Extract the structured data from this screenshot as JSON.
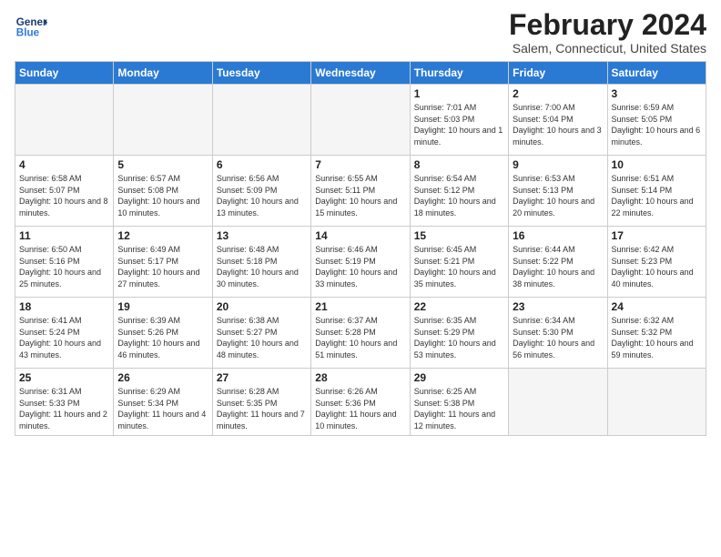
{
  "header": {
    "logo_line1": "General",
    "logo_line2": "Blue",
    "month_title": "February 2024",
    "location": "Salem, Connecticut, United States"
  },
  "weekdays": [
    "Sunday",
    "Monday",
    "Tuesday",
    "Wednesday",
    "Thursday",
    "Friday",
    "Saturday"
  ],
  "weeks": [
    [
      {
        "day": "",
        "info": ""
      },
      {
        "day": "",
        "info": ""
      },
      {
        "day": "",
        "info": ""
      },
      {
        "day": "",
        "info": ""
      },
      {
        "day": "1",
        "info": "Sunrise: 7:01 AM\nSunset: 5:03 PM\nDaylight: 10 hours and 1 minute."
      },
      {
        "day": "2",
        "info": "Sunrise: 7:00 AM\nSunset: 5:04 PM\nDaylight: 10 hours and 3 minutes."
      },
      {
        "day": "3",
        "info": "Sunrise: 6:59 AM\nSunset: 5:05 PM\nDaylight: 10 hours and 6 minutes."
      }
    ],
    [
      {
        "day": "4",
        "info": "Sunrise: 6:58 AM\nSunset: 5:07 PM\nDaylight: 10 hours and 8 minutes."
      },
      {
        "day": "5",
        "info": "Sunrise: 6:57 AM\nSunset: 5:08 PM\nDaylight: 10 hours and 10 minutes."
      },
      {
        "day": "6",
        "info": "Sunrise: 6:56 AM\nSunset: 5:09 PM\nDaylight: 10 hours and 13 minutes."
      },
      {
        "day": "7",
        "info": "Sunrise: 6:55 AM\nSunset: 5:11 PM\nDaylight: 10 hours and 15 minutes."
      },
      {
        "day": "8",
        "info": "Sunrise: 6:54 AM\nSunset: 5:12 PM\nDaylight: 10 hours and 18 minutes."
      },
      {
        "day": "9",
        "info": "Sunrise: 6:53 AM\nSunset: 5:13 PM\nDaylight: 10 hours and 20 minutes."
      },
      {
        "day": "10",
        "info": "Sunrise: 6:51 AM\nSunset: 5:14 PM\nDaylight: 10 hours and 22 minutes."
      }
    ],
    [
      {
        "day": "11",
        "info": "Sunrise: 6:50 AM\nSunset: 5:16 PM\nDaylight: 10 hours and 25 minutes."
      },
      {
        "day": "12",
        "info": "Sunrise: 6:49 AM\nSunset: 5:17 PM\nDaylight: 10 hours and 27 minutes."
      },
      {
        "day": "13",
        "info": "Sunrise: 6:48 AM\nSunset: 5:18 PM\nDaylight: 10 hours and 30 minutes."
      },
      {
        "day": "14",
        "info": "Sunrise: 6:46 AM\nSunset: 5:19 PM\nDaylight: 10 hours and 33 minutes."
      },
      {
        "day": "15",
        "info": "Sunrise: 6:45 AM\nSunset: 5:21 PM\nDaylight: 10 hours and 35 minutes."
      },
      {
        "day": "16",
        "info": "Sunrise: 6:44 AM\nSunset: 5:22 PM\nDaylight: 10 hours and 38 minutes."
      },
      {
        "day": "17",
        "info": "Sunrise: 6:42 AM\nSunset: 5:23 PM\nDaylight: 10 hours and 40 minutes."
      }
    ],
    [
      {
        "day": "18",
        "info": "Sunrise: 6:41 AM\nSunset: 5:24 PM\nDaylight: 10 hours and 43 minutes."
      },
      {
        "day": "19",
        "info": "Sunrise: 6:39 AM\nSunset: 5:26 PM\nDaylight: 10 hours and 46 minutes."
      },
      {
        "day": "20",
        "info": "Sunrise: 6:38 AM\nSunset: 5:27 PM\nDaylight: 10 hours and 48 minutes."
      },
      {
        "day": "21",
        "info": "Sunrise: 6:37 AM\nSunset: 5:28 PM\nDaylight: 10 hours and 51 minutes."
      },
      {
        "day": "22",
        "info": "Sunrise: 6:35 AM\nSunset: 5:29 PM\nDaylight: 10 hours and 53 minutes."
      },
      {
        "day": "23",
        "info": "Sunrise: 6:34 AM\nSunset: 5:30 PM\nDaylight: 10 hours and 56 minutes."
      },
      {
        "day": "24",
        "info": "Sunrise: 6:32 AM\nSunset: 5:32 PM\nDaylight: 10 hours and 59 minutes."
      }
    ],
    [
      {
        "day": "25",
        "info": "Sunrise: 6:31 AM\nSunset: 5:33 PM\nDaylight: 11 hours and 2 minutes."
      },
      {
        "day": "26",
        "info": "Sunrise: 6:29 AM\nSunset: 5:34 PM\nDaylight: 11 hours and 4 minutes."
      },
      {
        "day": "27",
        "info": "Sunrise: 6:28 AM\nSunset: 5:35 PM\nDaylight: 11 hours and 7 minutes."
      },
      {
        "day": "28",
        "info": "Sunrise: 6:26 AM\nSunset: 5:36 PM\nDaylight: 11 hours and 10 minutes."
      },
      {
        "day": "29",
        "info": "Sunrise: 6:25 AM\nSunset: 5:38 PM\nDaylight: 11 hours and 12 minutes."
      },
      {
        "day": "",
        "info": ""
      },
      {
        "day": "",
        "info": ""
      }
    ]
  ]
}
